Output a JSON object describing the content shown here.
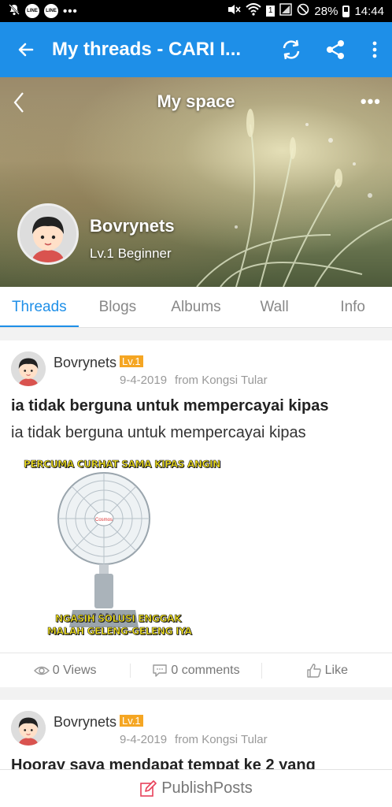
{
  "status_bar": {
    "left_icons": [
      "mute-icon",
      "line-app-icon",
      "line-app-icon"
    ],
    "line_label": "LINE",
    "overflow": "•••",
    "sim_badge": "1",
    "battery": "28%",
    "time": "14:44"
  },
  "app_bar": {
    "title": "My threads - CARI I..."
  },
  "banner": {
    "title": "My space",
    "more": "•••",
    "user_name": "Bovrynets",
    "level": "Lv.1 Beginner"
  },
  "tabs": [
    "Threads",
    "Blogs",
    "Albums",
    "Wall",
    "Info"
  ],
  "posts": [
    {
      "author": "Bovrynets",
      "level": "Lv.1",
      "date": "9-4-2019",
      "source": "from Kongsi Tular",
      "title": "ia tidak berguna untuk mempercayai kipas",
      "body": "ia tidak berguna untuk mempercayai kipas",
      "image_caption_top": "PERCUMA CURHAT SAMA KIPAS ANGIN",
      "image_caption_bottom_1": "NGASIH SOLUSI ENGGAK",
      "image_caption_bottom_2": "MALAH GELENG-GELENG IYA",
      "views": "0 Views",
      "comments": "0 comments",
      "like": "Like"
    },
    {
      "author": "Bovrynets",
      "level": "Lv.1",
      "date": "9-4-2019",
      "source": "from Kongsi Tular",
      "title": "Hooray saya mendapat tempat ke 2 yang"
    }
  ],
  "bottom_bar": {
    "label": "PublishPosts"
  },
  "colors": {
    "primary": "#1e8fe8",
    "level_badge": "#f5a623",
    "publish_icon": "#e8415a"
  }
}
